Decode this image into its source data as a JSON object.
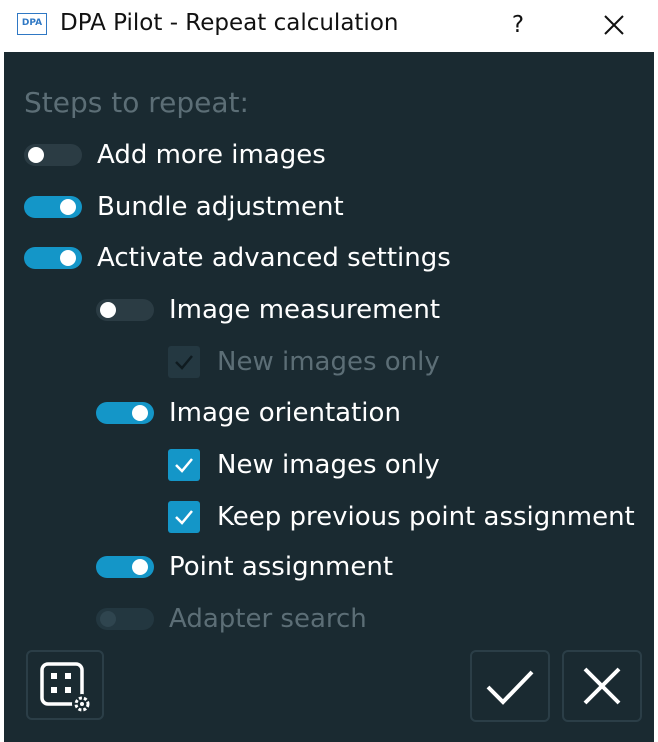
{
  "window": {
    "title": "DPA Pilot - Repeat calculation",
    "logo_text": "DPA",
    "help_label": "?"
  },
  "steps": {
    "heading": "Steps to repeat:",
    "add_more_images": {
      "label": "Add more images",
      "state": "off"
    },
    "bundle_adjustment": {
      "label": "Bundle adjustment",
      "state": "on"
    },
    "advanced_settings": {
      "label": "Activate advanced settings",
      "state": "on"
    },
    "image_measurement": {
      "label": "Image measurement",
      "state": "off"
    },
    "measurement_new_images_only": {
      "label": "New images only",
      "state": "checked-disabled"
    },
    "image_orientation": {
      "label": "Image orientation",
      "state": "on"
    },
    "orientation_new_images_only": {
      "label": "New images only",
      "state": "checked"
    },
    "keep_point_assignment": {
      "label": "Keep previous point assignment",
      "state": "checked"
    },
    "point_assignment": {
      "label": "Point assignment",
      "state": "on"
    },
    "adapter_search": {
      "label": "Adapter search",
      "state": "disabled"
    }
  },
  "footer": {
    "settings_icon": "grid-settings-icon",
    "ok_icon": "checkmark-icon",
    "cancel_icon": "close-icon"
  },
  "colors": {
    "panel_bg": "#1a2a31",
    "accent": "#1496c8",
    "dim_text": "#5c6e76"
  }
}
